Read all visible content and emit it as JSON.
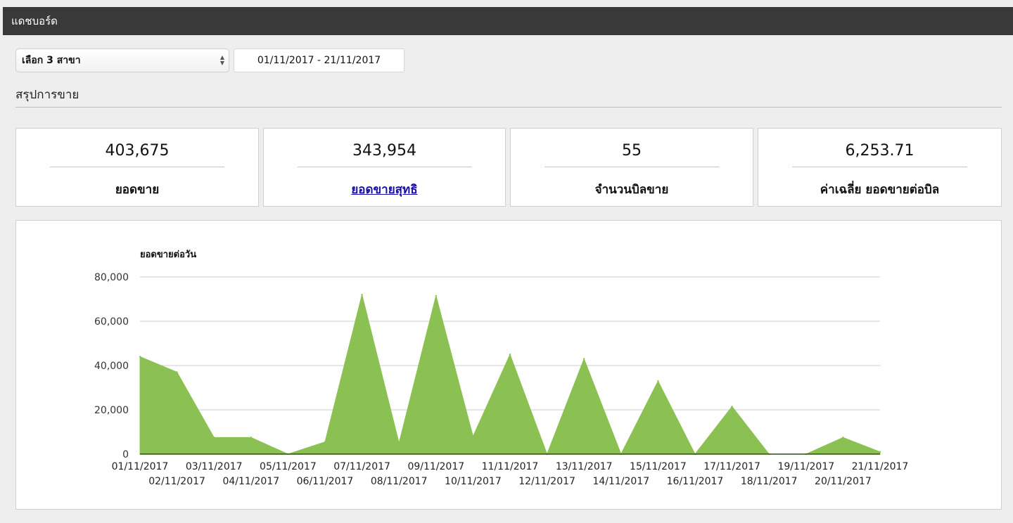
{
  "header": {
    "title": "แดชบอร์ด"
  },
  "filters": {
    "branch_select": "เลือก 3 สาขา",
    "date_range": "01/11/2017 - 21/11/2017"
  },
  "section": {
    "title": "สรุปการขาย"
  },
  "cards": [
    {
      "value": "403,675",
      "label": "ยอดขาย"
    },
    {
      "value": "343,954",
      "label": "ยอดขายสุทธิ"
    },
    {
      "value": "55",
      "label": "จำนวนบิลขาย"
    },
    {
      "value": "6,253.71",
      "label": "ค่าเฉลี่ย ยอดขายต่อบิล"
    }
  ],
  "colors": {
    "area": "#8bc152",
    "baseline": "#2d4b16",
    "grid": "#cccccc",
    "topbar": "#393939"
  },
  "chart_data": {
    "type": "area",
    "title": "ยอดขายต่อวัน",
    "xlabel": "",
    "ylabel": "",
    "ylim": [
      0,
      80000
    ],
    "yticks": [
      0,
      20000,
      40000,
      60000,
      80000
    ],
    "ytick_labels": [
      "0",
      "20,000",
      "40,000",
      "60,000",
      "80,000"
    ],
    "grid": true,
    "categories": [
      "01/11/2017",
      "02/11/2017",
      "03/11/2017",
      "04/11/2017",
      "05/11/2017",
      "06/11/2017",
      "07/11/2017",
      "08/11/2017",
      "09/11/2017",
      "10/11/2017",
      "11/11/2017",
      "12/11/2017",
      "13/11/2017",
      "14/11/2017",
      "15/11/2017",
      "16/11/2017",
      "17/11/2017",
      "18/11/2017",
      "19/11/2017",
      "20/11/2017",
      "21/11/2017"
    ],
    "series": [
      {
        "points": [
          [
            0,
            44000
          ],
          [
            1,
            37000
          ],
          [
            2,
            7500
          ],
          [
            3,
            7500
          ],
          [
            4,
            0
          ],
          [
            5,
            5500
          ],
          [
            6,
            72000
          ],
          [
            7,
            5000
          ],
          [
            8,
            71500
          ],
          [
            9,
            8000
          ],
          [
            10,
            45000
          ],
          [
            11,
            0
          ],
          [
            12,
            43000
          ],
          [
            13,
            0
          ],
          [
            14,
            33000
          ],
          [
            15,
            0
          ],
          [
            16,
            21500
          ],
          [
            17,
            0
          ],
          [
            18,
            0
          ],
          [
            19,
            7500
          ],
          [
            20,
            1000
          ]
        ]
      }
    ]
  }
}
